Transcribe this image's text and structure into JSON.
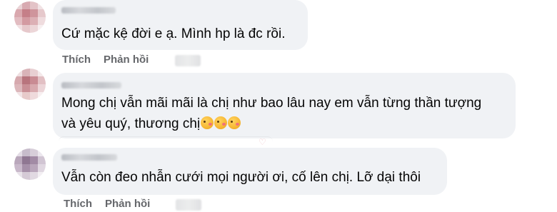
{
  "comments": [
    {
      "text": "Cứ mặc kệ đời e ạ. Mình hp là đc rồi.",
      "actions": [
        "Thích",
        "Phản hồi"
      ]
    },
    {
      "line1": "Mong chị vẫn mãi mãi là chị như bao lâu nay em vẫn từng thần tượng",
      "line2": "và yêu quý, thương chị"
    },
    {
      "text": "Vẫn còn đeo nhẫn cưới mọi người ơi, cố lên chị. Lỡ dại thôi",
      "actions": [
        "Thích",
        "Phản hồi"
      ]
    }
  ],
  "emoji_names": [
    "kiss-emoji",
    "kiss-emoji",
    "kiss-emoji"
  ]
}
